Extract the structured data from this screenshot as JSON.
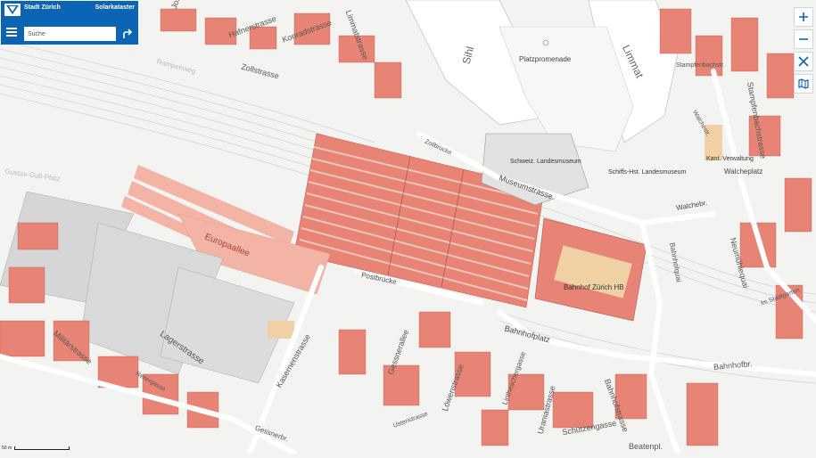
{
  "header": {
    "city": "Stadt Zürich",
    "app": "Solarkataster",
    "search_placeholder": "Suche"
  },
  "map": {
    "streets": [
      "Josefstrasse",
      "Hafnerstrasse",
      "Konradstrasse",
      "Zollstrasse",
      "Limmatstrasse",
      "Sihl",
      "Platzpromenade",
      "Limmat",
      "Stampfenbachstr.",
      "Stampfenbachstrasse",
      "Walchestr.",
      "Walcheplatz",
      "Walchebr.",
      "Neumühlequai",
      "Bahnhofquai",
      "Museumstrasse",
      "Schweiz. Landesmuseum",
      "Schiffs-Hst. Landesmuseum",
      "Kant. Verwaltung",
      "Zollbrücke",
      "Europaallee",
      "Postbrücke",
      "Bahnhof Zürich HB",
      "Bahnhofplatz",
      "Lagerstrasse",
      "Militärstrasse",
      "Kasernenstrasse",
      "Gessnerallee",
      "Löwenstrasse",
      "Uraniastrasse",
      "Schützengasse",
      "Bahnhofstrasse",
      "Beatenpl.",
      "Gustav-Gull-Platz",
      "Reitergasse",
      "Gessnerbr.",
      "Im Stadtgarten",
      "Usteristrasse",
      "Lintheschergasse",
      "Bahnhofbr.",
      "Rampenweg"
    ],
    "scale": "50 m"
  },
  "controls": {
    "zoom_in_icon": "plus-icon",
    "zoom_out_icon": "minus-icon",
    "locate_icon": "crosshair-icon",
    "layers_icon": "map-layers-icon"
  },
  "colors": {
    "header": "#0b64b4",
    "roof_high": "#e88475",
    "roof_medium": "#f3b4a6",
    "roof_low": "#efd1a5",
    "building_grey": "#d6d6d6"
  }
}
